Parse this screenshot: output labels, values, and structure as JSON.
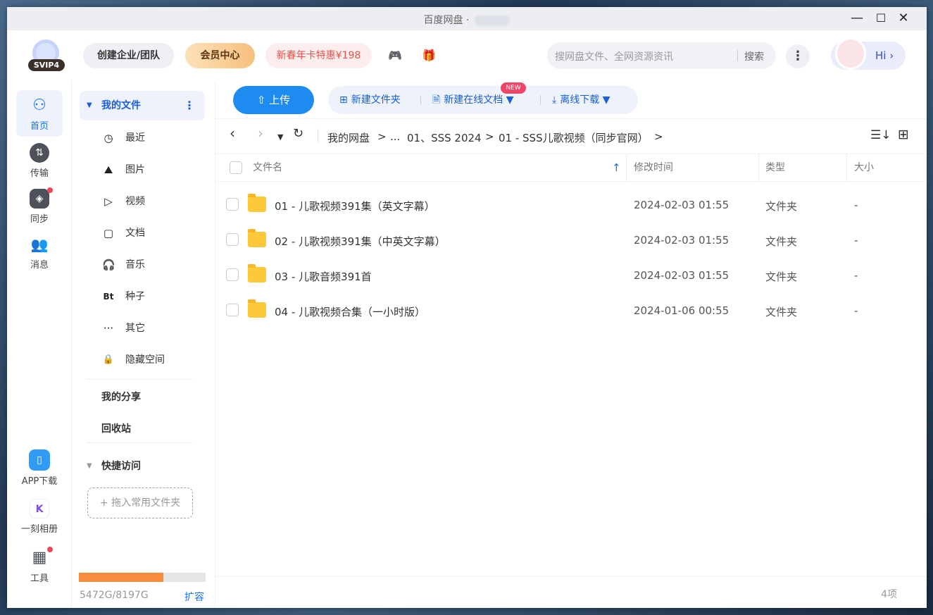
{
  "window": {
    "title": "百度网盘 ·",
    "minimize": "—",
    "maximize": "☐",
    "close": "✕"
  },
  "header": {
    "logo_tag": "SVIP4",
    "create_team": "创建企业/团队",
    "vip_center": "会员中心",
    "promo": "新春年卡特惠¥198",
    "game_icon": "🎮",
    "gift_icon": "🎁",
    "search_placeholder": "搜网盘文件、全网资源资讯",
    "search_button": "搜索",
    "more": "⋮",
    "greeting": "Hi ›"
  },
  "leftnav": [
    {
      "label": "首页",
      "icon": "⚇"
    },
    {
      "label": "传输",
      "icon": "⇅"
    },
    {
      "label": "同步",
      "icon": "◈"
    },
    {
      "label": "消息",
      "icon": "👥"
    },
    {
      "label": "APP下载",
      "icon": "▯"
    },
    {
      "label": "一刻相册",
      "icon": "K"
    },
    {
      "label": "工具",
      "icon": "▦"
    }
  ],
  "sidebar": {
    "my_files": "我的文件",
    "items": [
      {
        "label": "最近",
        "icon": "◷"
      },
      {
        "label": "图片",
        "icon": "⛰"
      },
      {
        "label": "视频",
        "icon": "▷"
      },
      {
        "label": "文档",
        "icon": "▢"
      },
      {
        "label": "音乐",
        "icon": "🎧"
      },
      {
        "label": "种子",
        "icon": "Bt"
      },
      {
        "label": "其它",
        "icon": "···"
      },
      {
        "label": "隐藏空间",
        "icon": "🔒"
      }
    ],
    "my_share": "我的分享",
    "recycle": "回收站",
    "quick_access": "快捷访问",
    "drop_hint": "+ 拖入常用文件夹",
    "storage_text": "5472G/8197G",
    "storage_used": 5472,
    "storage_total": 8197,
    "expand": "扩容"
  },
  "toolbar": {
    "upload": "上传",
    "new_folder": "新建文件夹",
    "new_doc": "新建在线文档",
    "new_badge": "NEW",
    "offline": "离线下载"
  },
  "path": {
    "crumbs": [
      "我的网盘",
      "...",
      "01、SSS 2024",
      "01 - SSS儿歌视频（同步官网）"
    ],
    "sep": ">"
  },
  "table": {
    "headers": {
      "name": "文件名",
      "mtime": "修改时间",
      "type": "类型",
      "size": "大小"
    },
    "rows": [
      {
        "name": "01 - 儿歌视频391集（英文字幕）",
        "mtime": "2024-02-03 01:55",
        "type": "文件夹",
        "size": "-"
      },
      {
        "name": "02 - 儿歌视频391集（中英文字幕）",
        "mtime": "2024-02-03 01:55",
        "type": "文件夹",
        "size": "-"
      },
      {
        "name": "03 - 儿歌音频391首",
        "mtime": "2024-02-03 01:55",
        "type": "文件夹",
        "size": "-"
      },
      {
        "name": "04 - 儿歌视频合集（一小时版）",
        "mtime": "2024-01-06 00:55",
        "type": "文件夹",
        "size": "-"
      }
    ],
    "count": "4项"
  }
}
